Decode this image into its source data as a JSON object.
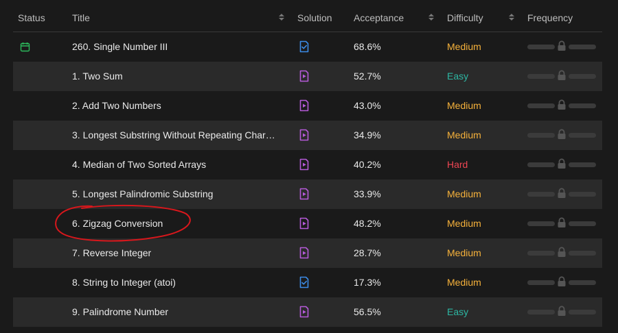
{
  "headers": {
    "status": "Status",
    "title": "Title",
    "solution": "Solution",
    "acceptance": "Acceptance",
    "difficulty": "Difficulty",
    "frequency": "Frequency"
  },
  "colors": {
    "easy": "#2db7a3",
    "medium": "#f7b23b",
    "hard": "#ef4654",
    "solution_video": "#b55ad8",
    "solution_article": "#3c8ce7",
    "status_calendar": "#2cbb5d",
    "annotation": "#d8171c"
  },
  "rows": [
    {
      "title": "260. Single Number III",
      "solution_icon": "article-check-icon",
      "acceptance": "68.6%",
      "difficulty": "Medium",
      "status_icon": "calendar-icon"
    },
    {
      "title": "1. Two Sum",
      "solution_icon": "video-file-icon",
      "acceptance": "52.7%",
      "difficulty": "Easy"
    },
    {
      "title": "2. Add Two Numbers",
      "solution_icon": "video-file-icon",
      "acceptance": "43.0%",
      "difficulty": "Medium"
    },
    {
      "title": "3. Longest Substring Without Repeating Chara...",
      "solution_icon": "video-file-icon",
      "acceptance": "34.9%",
      "difficulty": "Medium"
    },
    {
      "title": "4. Median of Two Sorted Arrays",
      "solution_icon": "video-file-icon",
      "acceptance": "40.2%",
      "difficulty": "Hard"
    },
    {
      "title": "5. Longest Palindromic Substring",
      "solution_icon": "video-file-icon",
      "acceptance": "33.9%",
      "difficulty": "Medium"
    },
    {
      "title": "6. Zigzag Conversion",
      "solution_icon": "video-file-icon",
      "acceptance": "48.2%",
      "difficulty": "Medium",
      "annotated": true
    },
    {
      "title": "7. Reverse Integer",
      "solution_icon": "video-file-icon",
      "acceptance": "28.7%",
      "difficulty": "Medium"
    },
    {
      "title": "8. String to Integer (atoi)",
      "solution_icon": "article-check-icon",
      "acceptance": "17.3%",
      "difficulty": "Medium"
    },
    {
      "title": "9. Palindrome Number",
      "solution_icon": "video-file-icon",
      "acceptance": "56.5%",
      "difficulty": "Easy"
    }
  ]
}
